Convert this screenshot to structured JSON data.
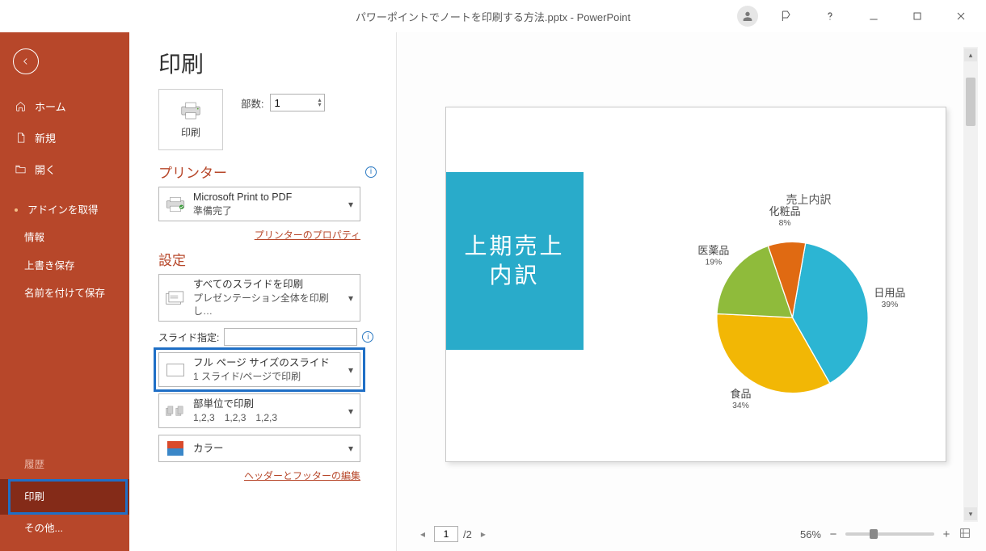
{
  "titlebar": {
    "title": "パワーポイントでノートを印刷する方法.pptx  -  PowerPoint"
  },
  "sidebar": {
    "home": "ホーム",
    "new": "新規",
    "open": "開く",
    "get_addins": "アドインを取得",
    "info": "情報",
    "save": "上書き保存",
    "save_as": "名前を付けて保存",
    "history": "履歴",
    "print": "印刷",
    "more": "その他..."
  },
  "center": {
    "page_title": "印刷",
    "print_button": "印刷",
    "copies_label": "部数:",
    "copies_value": "1",
    "printer_section": "プリンター",
    "printer_name": "Microsoft Print to PDF",
    "printer_status": "準備完了",
    "printer_props_link": "プリンターのプロパティ",
    "settings_section": "設定",
    "print_all_main": "すべてのスライドを印刷",
    "print_all_sub": "プレゼンテーション全体を印刷し…",
    "slide_range_label": "スライド指定:",
    "layout_main": "フル ページ サイズのスライド",
    "layout_sub": "1 スライド/ページで印刷",
    "collate_main": "部単位で印刷",
    "collate_sub": "1,2,3　1,2,3　1,2,3",
    "color_main": "カラー",
    "hf_link": "ヘッダーとフッターの編集"
  },
  "preview": {
    "slide_title": "上期売上\n内訳",
    "chart_title": "売上内訳",
    "page_current": "1",
    "page_total": "/2",
    "zoom_value": "56%"
  },
  "chart_data": {
    "type": "pie",
    "title": "売上内訳",
    "series": [
      {
        "name": "日用品",
        "value": 39,
        "label": "日用品",
        "value_label": "39%",
        "color": "#2cb5d3"
      },
      {
        "name": "食品",
        "value": 34,
        "label": "食品",
        "value_label": "34%",
        "color": "#f2b705"
      },
      {
        "name": "医薬品",
        "value": 19,
        "label": "医薬品",
        "value_label": "19%",
        "color": "#8fbb3b"
      },
      {
        "name": "化粧品",
        "value": 8,
        "label": "化粧品",
        "value_label": "8%",
        "color": "#e06a12"
      }
    ]
  }
}
